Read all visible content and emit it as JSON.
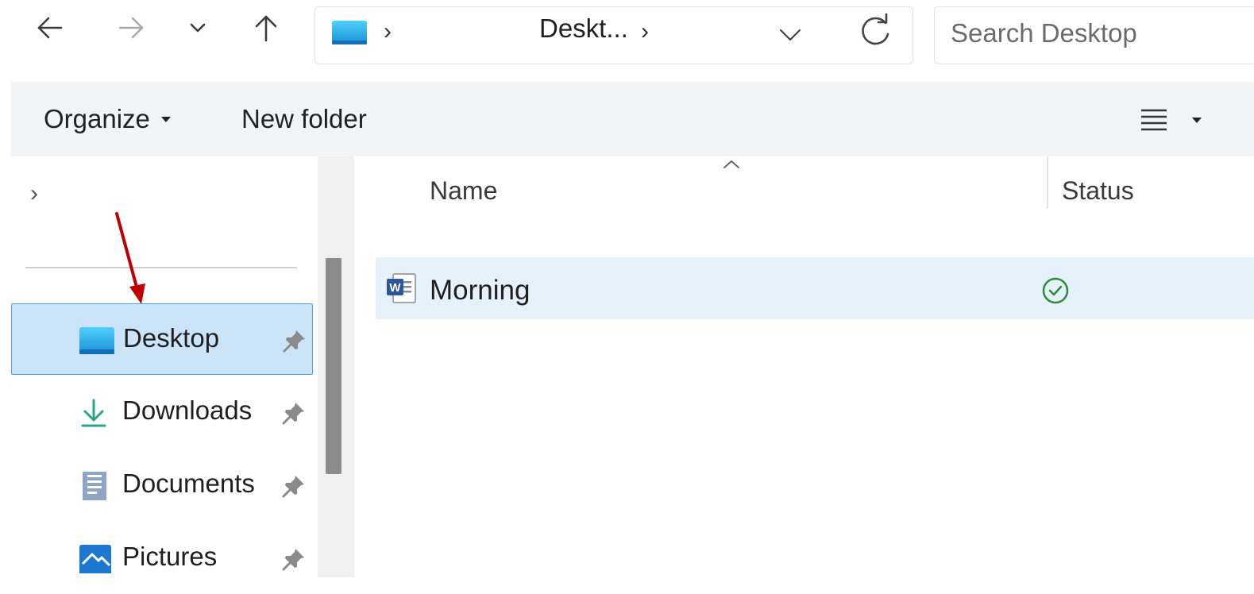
{
  "navigation": {
    "back_icon": "arrow-left-icon",
    "forward_icon": "arrow-right-icon",
    "recent_icon": "chevron-down-icon",
    "up_icon": "arrow-up-icon"
  },
  "address_bar": {
    "folder_icon": "desktop-folder-icon",
    "path_label": "Deskt...",
    "separator": "›",
    "dropdown_icon": "chevron-down-icon",
    "refresh_icon": "refresh-icon"
  },
  "search": {
    "placeholder": "Search Desktop"
  },
  "command_bar": {
    "organize_label": "Organize",
    "new_folder_label": "New folder",
    "view_icon": "list-view-icon"
  },
  "nav_pane": {
    "expand_glyph": "›",
    "items": [
      {
        "label": "Desktop",
        "icon": "desktop-folder-icon",
        "pinned": true,
        "selected": true
      },
      {
        "label": "Downloads",
        "icon": "download-icon",
        "pinned": true,
        "selected": false
      },
      {
        "label": "Documents",
        "icon": "document-icon",
        "pinned": true,
        "selected": false
      },
      {
        "label": "Pictures",
        "icon": "pictures-icon",
        "pinned": true,
        "selected": false
      }
    ]
  },
  "file_list": {
    "columns": [
      {
        "label": "Name",
        "sorted": "ascending"
      },
      {
        "label": "Status"
      }
    ],
    "rows": [
      {
        "name": "Morning",
        "icon": "word-document-icon",
        "status_icon": "synced-check-icon",
        "selected": true
      }
    ]
  },
  "colors": {
    "selection_bg": "#cce4f7",
    "selection_border": "#4d9de0",
    "row_hover_bg": "#e5f1fb",
    "command_bar_bg": "#f3f4f6",
    "annotation_arrow": "#c00000",
    "status_green": "#2e8b3a",
    "word_blue": "#2b579a"
  }
}
